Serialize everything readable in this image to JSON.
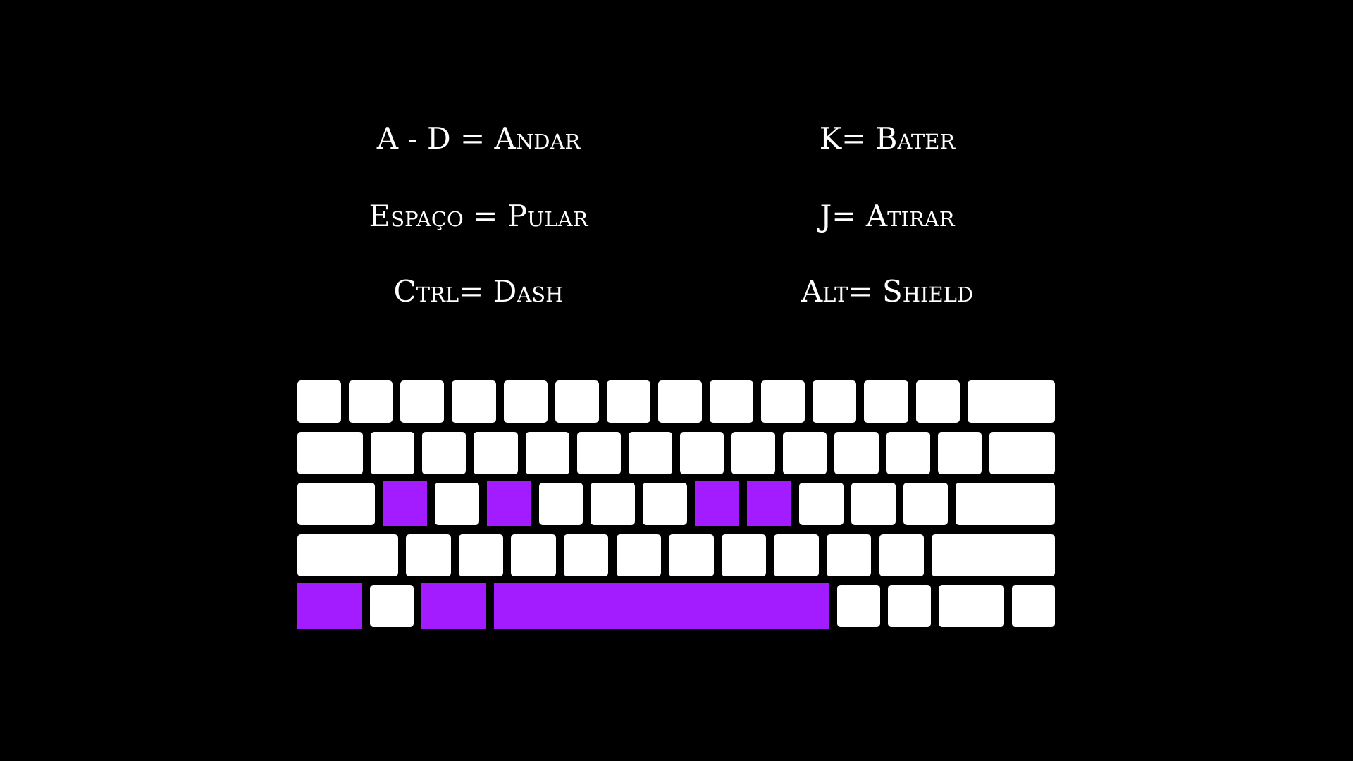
{
  "colors": {
    "background": "#000000",
    "key": "#ffffff",
    "highlight": "#a21cff",
    "text": "#ffffff"
  },
  "controls": {
    "left": [
      {
        "text": "A - D = Andar"
      },
      {
        "text": "Espaço = Pular"
      },
      {
        "text": "Ctrl= Dash"
      }
    ],
    "right": [
      {
        "text": "K= Bater"
      },
      {
        "text": "J= Atirar"
      },
      {
        "text": "Alt= Shield"
      }
    ]
  },
  "keyboard": {
    "rows": [
      {
        "keys": [
          {
            "w": 1
          },
          {
            "w": 1
          },
          {
            "w": 1
          },
          {
            "w": 1
          },
          {
            "w": 1
          },
          {
            "w": 1
          },
          {
            "w": 1
          },
          {
            "w": 1
          },
          {
            "w": 1
          },
          {
            "w": 1
          },
          {
            "w": 1
          },
          {
            "w": 1
          },
          {
            "w": 1
          },
          {
            "w": 2
          }
        ]
      },
      {
        "keys": [
          {
            "w": 1.5
          },
          {
            "w": 1
          },
          {
            "w": 1
          },
          {
            "w": 1
          },
          {
            "w": 1
          },
          {
            "w": 1
          },
          {
            "w": 1
          },
          {
            "w": 1
          },
          {
            "w": 1
          },
          {
            "w": 1
          },
          {
            "w": 1
          },
          {
            "w": 1
          },
          {
            "w": 1
          },
          {
            "w": 1.5
          }
        ]
      },
      {
        "keys": [
          {
            "w": 1.75
          },
          {
            "w": 1,
            "highlight": true,
            "name": "key-a"
          },
          {
            "w": 1
          },
          {
            "w": 1,
            "highlight": true,
            "name": "key-d"
          },
          {
            "w": 1
          },
          {
            "w": 1
          },
          {
            "w": 1
          },
          {
            "w": 1,
            "highlight": true,
            "name": "key-j"
          },
          {
            "w": 1,
            "highlight": true,
            "name": "key-k"
          },
          {
            "w": 1
          },
          {
            "w": 1
          },
          {
            "w": 1
          },
          {
            "w": 2.25
          }
        ]
      },
      {
        "keys": [
          {
            "w": 2.25
          },
          {
            "w": 1
          },
          {
            "w": 1
          },
          {
            "w": 1
          },
          {
            "w": 1
          },
          {
            "w": 1
          },
          {
            "w": 1
          },
          {
            "w": 1
          },
          {
            "w": 1
          },
          {
            "w": 1
          },
          {
            "w": 1
          },
          {
            "w": 2.75
          }
        ]
      },
      {
        "keys": [
          {
            "w": 1.5,
            "highlight": true,
            "name": "key-ctrl"
          },
          {
            "w": 1
          },
          {
            "w": 1.5,
            "highlight": true,
            "name": "key-alt"
          },
          {
            "w": 7.75,
            "highlight": true,
            "name": "key-space"
          },
          {
            "w": 1
          },
          {
            "w": 1
          },
          {
            "w": 1.5
          },
          {
            "w": 1
          }
        ]
      }
    ]
  }
}
